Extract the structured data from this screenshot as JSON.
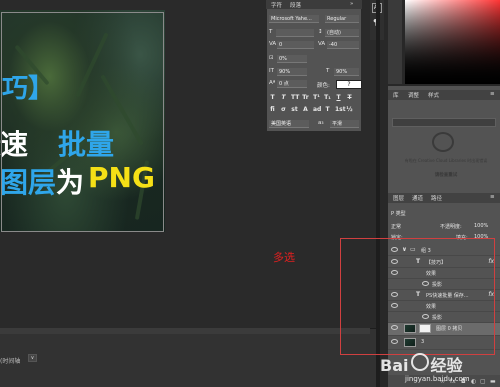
{
  "canvas": {
    "headline_line1": "巧】",
    "headline_line2_a": "速",
    "headline_line2_b": "批量",
    "headline_line3_a": "图层",
    "headline_line3_b": "为",
    "headline_line3_c": "PNG",
    "timeline_label": "(时间轴",
    "timeline_dropdown": "∨"
  },
  "character_panel": {
    "tabs": [
      "字符",
      "段落"
    ],
    "font_family": "Microsoft Yahe...",
    "font_style": "Regular",
    "font_size": "T",
    "leading": "(自动)",
    "kerning": "0",
    "tracking": "-40",
    "scale_label_v": "0%",
    "vertical_scale": "90%",
    "horizontal_scale": "90%",
    "baseline_shift": "0 点",
    "color_label": "颜色:",
    "color_value": "?",
    "style_buttons": [
      "T",
      "T",
      "TT",
      "Tr",
      "T¹",
      "T₁",
      "T",
      "T"
    ],
    "ot_buttons": [
      "fi",
      "σ",
      "st",
      "A",
      "ad",
      "T",
      "1st",
      "½"
    ],
    "language": "美国英语",
    "aa": "a₃",
    "aa_value": "平滑"
  },
  "toolstrip": {
    "ai_label": "A|",
    "para_label": "¶"
  },
  "libraries_panel": {
    "tabs": [
      "库",
      "调整",
      "样式"
    ],
    "cc_message": "有啦在 Creative Cloud Libraries 时出现错误",
    "cc_sub": "请检查重试"
  },
  "layers_panel": {
    "tabs": [
      "图层",
      "通道",
      "路径"
    ],
    "filter_label": "P 类型",
    "blend_mode": "正常",
    "opacity_label": "不透明度:",
    "opacity_value": "100%",
    "lock_label": "锁定:",
    "fill_label": "填充:",
    "fill_value": "100%",
    "rows": [
      {
        "type": "group",
        "label": "组 3"
      },
      {
        "type": "text",
        "label": "【技巧】",
        "fx": "fx"
      },
      {
        "type": "effect-header",
        "label": "效果"
      },
      {
        "type": "effect",
        "label": "投影"
      },
      {
        "type": "text",
        "label": "PS快速批量 保存...",
        "fx": "fx"
      },
      {
        "type": "effect-header",
        "label": "效果"
      },
      {
        "type": "effect",
        "label": "投影"
      },
      {
        "type": "image-mask",
        "label": "图层 0 拷贝"
      },
      {
        "type": "image",
        "label": "3"
      }
    ]
  },
  "annotation": {
    "multi_select": "多选"
  },
  "watermark": {
    "brand_left": "Bai",
    "brand_right": "经验",
    "url": "jingyan.baidu.com"
  }
}
